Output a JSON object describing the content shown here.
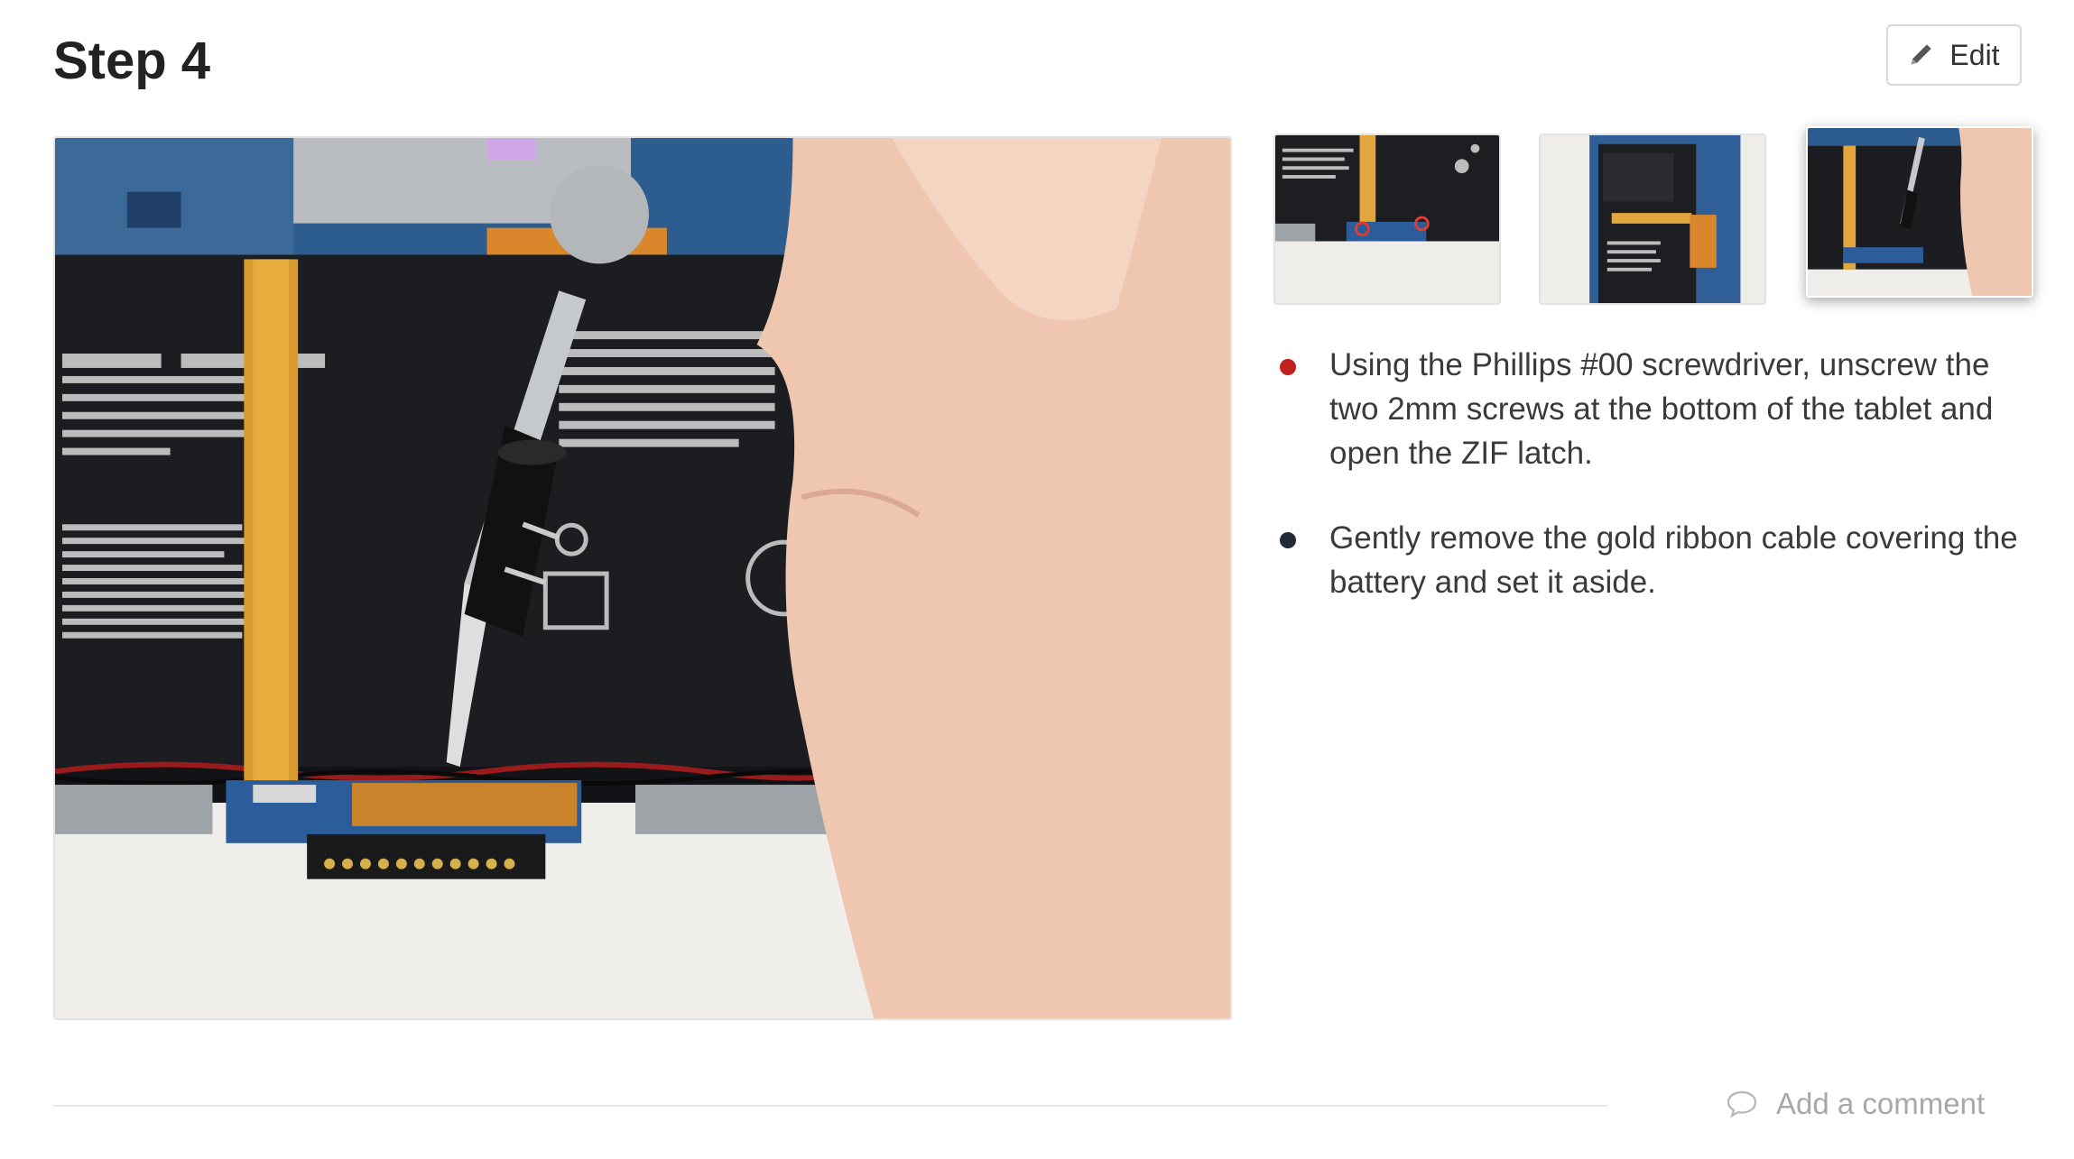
{
  "step": {
    "title": "Step 4"
  },
  "toolbar": {
    "edit_label": "Edit",
    "edit_icon": "pencil-icon"
  },
  "gallery": {
    "main_image": "screwdriver-removing-screws-photo",
    "thumbnails": [
      {
        "name": "thumbnail-1",
        "selected": false
      },
      {
        "name": "thumbnail-2",
        "selected": false
      },
      {
        "name": "thumbnail-3",
        "selected": true
      }
    ]
  },
  "instructions": [
    {
      "color": "#c0211f",
      "text": "Using the Phillips #00 screwdriver, unscrew the two 2mm screws at the bottom of the tablet and open the ZIF latch."
    },
    {
      "color": "#222a33",
      "text": "Gently remove the gold ribbon cable covering the battery and set it aside."
    }
  ],
  "footer": {
    "comment_label": "Add a comment",
    "comment_icon": "speech-bubble-icon"
  }
}
